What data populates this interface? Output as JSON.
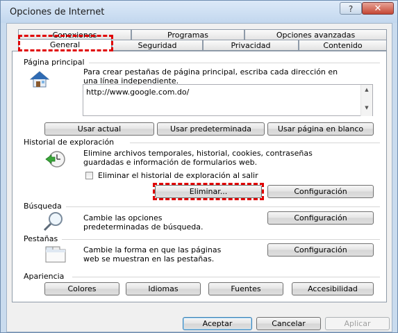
{
  "window": {
    "title": "Opciones de Internet",
    "help": "?",
    "close": "✕"
  },
  "tabs_back": [
    "Conexiones",
    "Programas",
    "Opciones avanzadas"
  ],
  "tabs_front": [
    "General",
    "Seguridad",
    "Privacidad",
    "Contenido"
  ],
  "home": {
    "label": "Página principal",
    "desc1": "Para crear pestañas de página principal, escriba cada dirección en",
    "desc2": "una línea independiente.",
    "url": "http://www.google.com.do/",
    "btn_current": "Usar actual",
    "btn_default": "Usar predeterminada",
    "btn_blank": "Usar página en blanco"
  },
  "history": {
    "label": "Historial de exploración",
    "desc1": "Elimine archivos temporales, historial, cookies, contraseñas",
    "desc2": "guardadas e información de formularios web.",
    "checkbox": "Eliminar el historial de exploración al salir",
    "btn_delete": "Eliminar...",
    "btn_settings": "Configuración"
  },
  "search": {
    "label": "Búsqueda",
    "desc1": "Cambie las opciones",
    "desc2": "predeterminadas de búsqueda.",
    "btn_settings": "Configuración"
  },
  "tabs_section": {
    "label": "Pestañas",
    "desc1": "Cambie la forma en que las páginas",
    "desc2": "web se muestran en las pestañas.",
    "btn_settings": "Configuración"
  },
  "appearance": {
    "label": "Apariencia",
    "btn_colors": "Colores",
    "btn_languages": "Idiomas",
    "btn_fonts": "Fuentes",
    "btn_access": "Accesibilidad"
  },
  "footer": {
    "ok": "Aceptar",
    "cancel": "Cancelar",
    "apply": "Aplicar"
  }
}
